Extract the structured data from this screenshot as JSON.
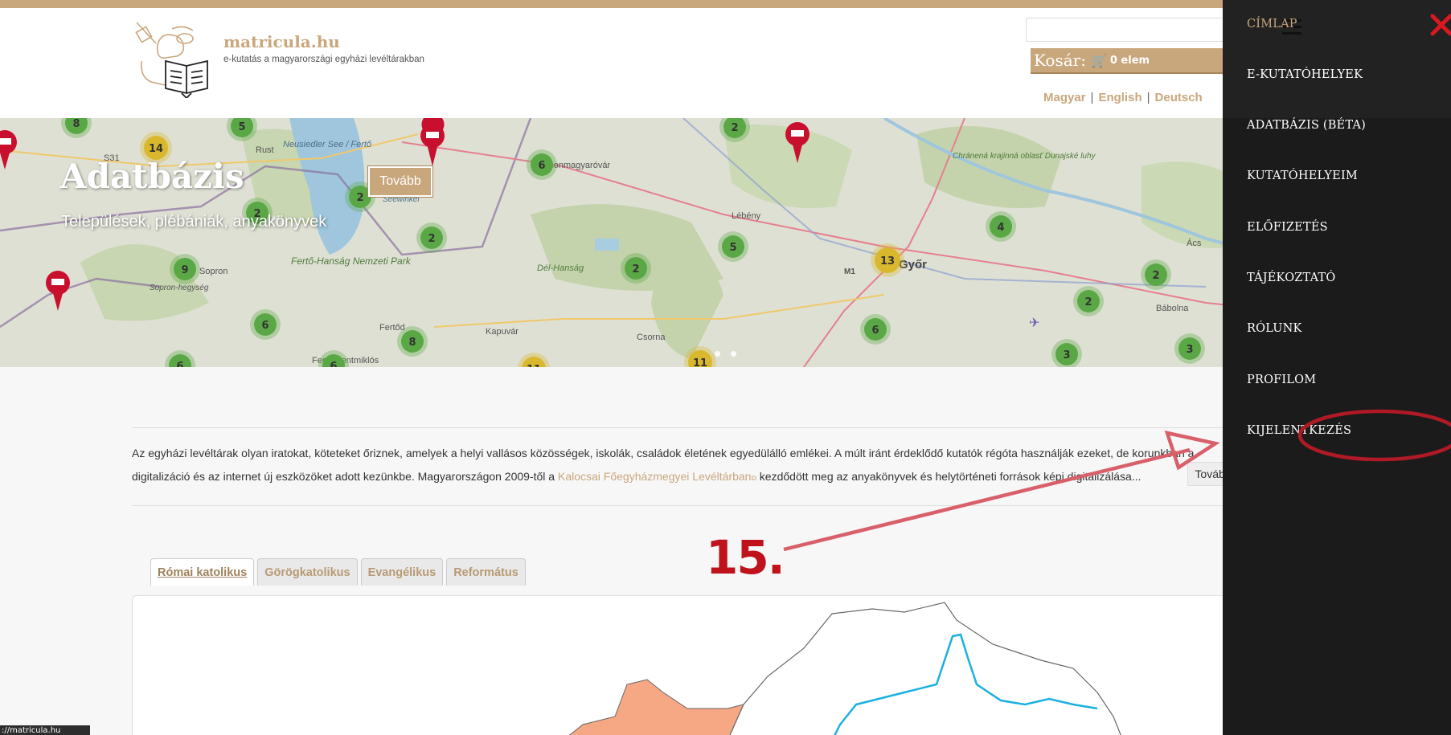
{
  "header": {
    "site_title": "matricula.hu",
    "site_subtitle": "e-kutatás a magyarországi egyházi levéltárakban",
    "cart": {
      "label": "Kosár:",
      "count": "0 elem",
      "icon": "cart-icon"
    },
    "languages": [
      "Magyar",
      "English",
      "Deutsch"
    ]
  },
  "hero": {
    "title": "Adatbázis",
    "subtitle": "Települések, plébániák, anyakönyvek",
    "button": "Tovább",
    "map_labels": [
      "S31",
      "Rust",
      "Neusiedler See / Fertő",
      "Mosonmagyaróvár",
      "Lébény",
      "Chránená krajinná oblasť Dunajské luhy",
      "Ács",
      "Sopron",
      "Sopron-hegység",
      "Fertő-Hanság Nemzeti Park",
      "Dél-Hanság",
      "M1",
      "Győr",
      "Bábolna",
      "Fertőd",
      "Csorna",
      "Kapuvár",
      "Fertőszentmiklós",
      "Seewinkel"
    ],
    "clusters": [
      "8",
      "5",
      "14",
      "2",
      "6",
      "2",
      "2",
      "4",
      "2",
      "9",
      "2",
      "5",
      "2",
      "13",
      "2",
      "6",
      "8",
      "6",
      "3",
      "3",
      "6",
      "6",
      "11",
      "11"
    ]
  },
  "intro": {
    "line1": "Az egyházi levéltárak olyan iratokat, köteteket őriznek, amelyek a helyi vallásos közösségek, iskolák, családok életének egyedülálló emlékei. A múlt iránt érdeklődő kutatók régóta használják ezeket, de korunkban a",
    "line2_before": "digitalizáció és az internet új eszközöket adott kezünkbe. Magyarországon 2009-től a",
    "link": "Kalocsai Főegyházmegyei Levéltárban",
    "line2_after": "kezdődött meg az anyakönyvek és helytörténeti források képi digitalizálása...",
    "read_more": "Tovább olvasom"
  },
  "tabs": [
    {
      "label": "Római katolikus",
      "active": true
    },
    {
      "label": "Görögkatolikus",
      "active": false
    },
    {
      "label": "Evangélikus",
      "active": false
    },
    {
      "label": "Református",
      "active": false
    }
  ],
  "status_url": "://matricula.hu",
  "side_menu": {
    "items": [
      {
        "label": "CÍMLAP",
        "active": true
      },
      {
        "label": "E-KUTATÓHELYEK",
        "active": false
      },
      {
        "label": "ADATBÁZIS (BÉTA)",
        "active": false
      },
      {
        "label": "KUTATÓHELYEIM",
        "active": false
      },
      {
        "label": "ELŐFIZETÉS",
        "active": false
      },
      {
        "label": "TÁJÉKOZTATÓ",
        "active": false
      },
      {
        "label": "RÓLUNK",
        "active": false
      },
      {
        "label": "PROFILOM",
        "active": false
      },
      {
        "label": "KIJELENTKEZÉS",
        "active": false
      }
    ]
  },
  "annotation": {
    "step": "15.",
    "color": "#c0121b"
  },
  "colors": {
    "brand": "#c9a77c",
    "menu_bg": "#1b1b1b",
    "cluster_green": "#5aa845",
    "cluster_yellow": "#d9b82e",
    "marker_red": "#c8102e"
  }
}
